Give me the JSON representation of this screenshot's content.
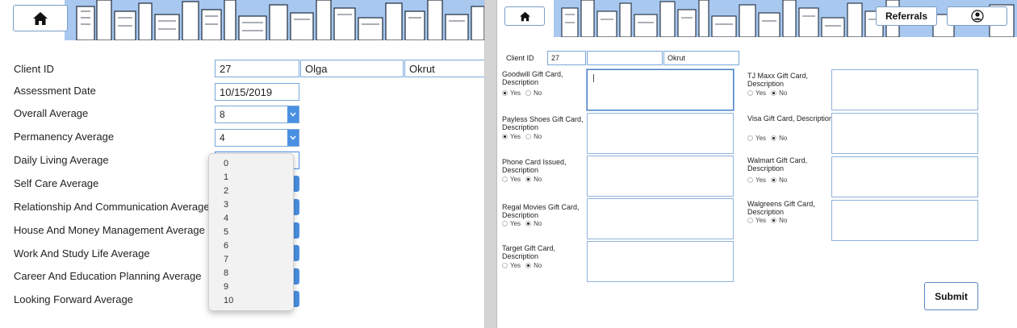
{
  "left": {
    "fields": {
      "client_id": {
        "label": "Client ID",
        "id": "27",
        "first_name": "Olga",
        "last_name": "Okrut"
      },
      "assessment_date": {
        "label": "Assessment Date",
        "value": "10/15/2019"
      },
      "overall_average": {
        "label": "Overall Average",
        "value": "8"
      },
      "permanency_average": {
        "label": "Permanency Average",
        "value": "4"
      },
      "daily_living_average": {
        "label": "Daily Living Average"
      },
      "self_care_average": {
        "label": "Self Care Average"
      },
      "relationship_average": {
        "label": "Relationship And Communication Average"
      },
      "house_money_average": {
        "label": "House And Money Management Average"
      },
      "work_study_average": {
        "label": "Work And Study Life Average"
      },
      "career_education_average": {
        "label": "Career And Education Planning Average"
      },
      "looking_forward_average": {
        "label": "Looking Forward Average"
      }
    },
    "dropdown_options": [
      "0",
      "1",
      "2",
      "3",
      "4",
      "5",
      "6",
      "7",
      "8",
      "9",
      "10"
    ]
  },
  "right": {
    "header": {
      "referrals_label": "Referrals"
    },
    "client": {
      "label": "Client ID",
      "id": "27",
      "first_name": "",
      "last_name": "Okrut"
    },
    "radio_yes": "Yes",
    "radio_no": "No",
    "gift_cards_left": [
      {
        "label": "Goodwill Gift Card, Description",
        "selected": "yes"
      },
      {
        "label": "Payless Shoes Gift Card, Description",
        "selected": "yes"
      },
      {
        "label": "Phone Card Issued, Description",
        "selected": "no"
      },
      {
        "label": "Regal Movies Gift Card, Description",
        "selected": "no"
      },
      {
        "label": "Target Gift Card, Description",
        "selected": "no"
      }
    ],
    "gift_cards_right": [
      {
        "label": "TJ Maxx Gift Card, Description",
        "selected": "no"
      },
      {
        "label": "Visa Gift Card, Description",
        "selected": "no"
      },
      {
        "label": "Walmart Gift Card, Description",
        "selected": "no"
      },
      {
        "label": "Walgreens Gift Card, Description",
        "selected": "no"
      }
    ],
    "submit_label": "Submit"
  },
  "colors": {
    "accent": "#4a90e2",
    "border": "#7aa7d9",
    "banner_sky": "#9fc3ee"
  }
}
